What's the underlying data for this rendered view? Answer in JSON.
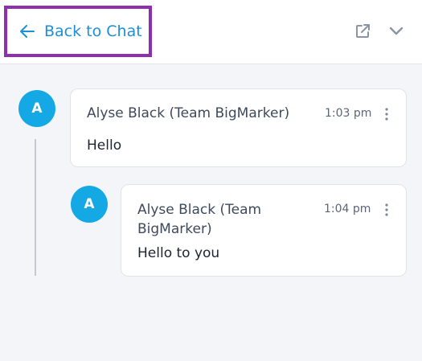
{
  "header": {
    "back_label": "Back to Chat",
    "icons": {
      "back": "arrow-left-icon",
      "popout": "external-link-icon",
      "collapse": "chevron-down-icon"
    }
  },
  "thread": {
    "parent": {
      "avatar_initial": "A",
      "author": "Alyse Black (Team BigMarker)",
      "time": "1:03 pm",
      "text": "Hello"
    },
    "reply": {
      "avatar_initial": "A",
      "author": "Alyse Black (Team BigMarker)",
      "time": "1:04 pm",
      "text": "Hello to you"
    }
  },
  "colors": {
    "accent": "#1e8fd6",
    "avatar": "#14a8e5",
    "highlight": "#8e2fb0"
  }
}
